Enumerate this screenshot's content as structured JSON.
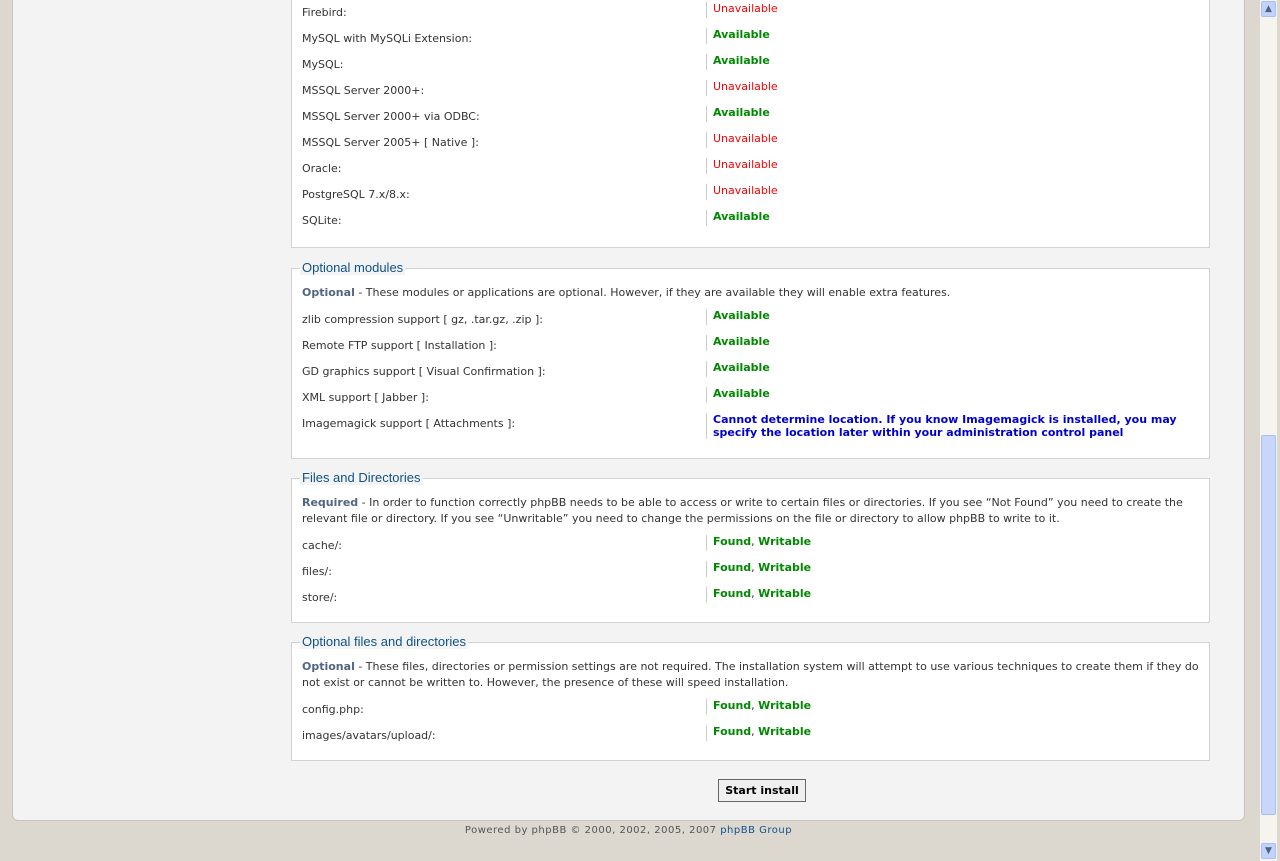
{
  "db": [
    {
      "label": "Firebird:",
      "status": "Unavailable",
      "ok": false
    },
    {
      "label": "MySQL with MySQLi Extension:",
      "status": "Available",
      "ok": true
    },
    {
      "label": "MySQL:",
      "status": "Available",
      "ok": true
    },
    {
      "label": "MSSQL Server 2000+:",
      "status": "Unavailable",
      "ok": false
    },
    {
      "label": "MSSQL Server 2000+ via ODBC:",
      "status": "Available",
      "ok": true
    },
    {
      "label": "MSSQL Server 2005+ [ Native ]:",
      "status": "Unavailable",
      "ok": false
    },
    {
      "label": "Oracle:",
      "status": "Unavailable",
      "ok": false
    },
    {
      "label": "PostgreSQL 7.x/8.x:",
      "status": "Unavailable",
      "ok": false
    },
    {
      "label": "SQLite:",
      "status": "Available",
      "ok": true
    }
  ],
  "optional_modules": {
    "title": "Optional modules",
    "desc_bold": "Optional",
    "desc": " - These modules or applications are optional. However, if they are available they will enable extra features.",
    "rows": [
      {
        "label": "zlib compression support [ gz, .tar.gz, .zip ]:",
        "status": "Available"
      },
      {
        "label": "Remote FTP support [ Installation ]:",
        "status": "Available"
      },
      {
        "label": "GD graphics support [ Visual Confirmation ]:",
        "status": "Available"
      },
      {
        "label": "XML support [ Jabber ]:",
        "status": "Available"
      },
      {
        "label": "Imagemagick support [ Attachments ]:",
        "status": "Cannot determine location. If you know Imagemagick is installed, you may specify the location later within your administration control panel"
      }
    ]
  },
  "files": {
    "title": "Files and Directories",
    "desc_bold": "Required",
    "desc": " - In order to function correctly phpBB needs to be able to access or write to certain files or directories. If you see “Not Found” you need to create the relevant file or directory. If you see “Unwritable” you need to change the permissions on the file or directory to allow phpBB to write to it.",
    "rows": [
      {
        "label": "cache/:",
        "found": "Found",
        "writable": "Writable"
      },
      {
        "label": "files/:",
        "found": "Found",
        "writable": "Writable"
      },
      {
        "label": "store/:",
        "found": "Found",
        "writable": "Writable"
      }
    ]
  },
  "optional_files": {
    "title": "Optional files and directories",
    "desc_bold": "Optional",
    "desc": " - These files, directories or permission settings are not required. The installation system will attempt to use various techniques to create them if they do not exist or cannot be written to. However, the presence of these will speed installation.",
    "rows": [
      {
        "label": "config.php:",
        "found": "Found",
        "writable": "Writable"
      },
      {
        "label": "images/avatars/upload/:",
        "found": "Found",
        "writable": "Writable"
      }
    ]
  },
  "start_install": "Start install",
  "footer": {
    "text": "Powered by phpBB © 2000, 2002, 2005, 2007 ",
    "link": "phpBB Group"
  },
  "colors": {
    "available": "#008000",
    "unavailable": "#ff0000",
    "info": "#0000cc",
    "legend": "#105289"
  }
}
